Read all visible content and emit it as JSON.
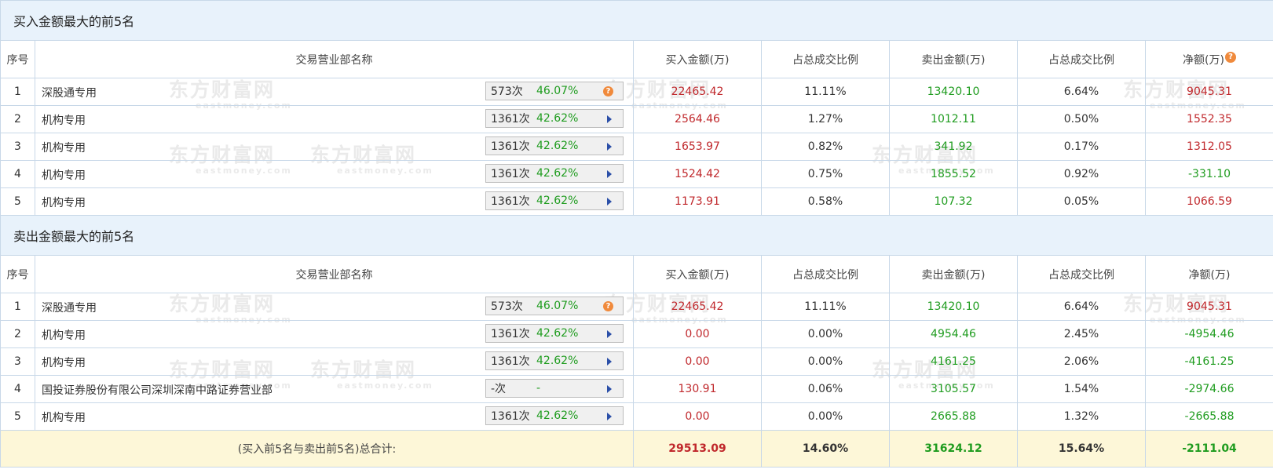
{
  "buy_section": {
    "title": "买入金额最大的前5名",
    "headers": [
      "序号",
      "交易营业部名称",
      "买入金额(万)",
      "占总成交比例",
      "卖出金额(万)",
      "占总成交比例",
      "净额(万)"
    ],
    "rows": [
      {
        "idx": "1",
        "name": "深股通专用",
        "count": "573次",
        "pct": "46.07%",
        "icon": "question-icon",
        "buy": "22465.42",
        "buy_ratio": "11.11%",
        "sell": "13420.10",
        "sell_ratio": "6.64%",
        "net": "9045.31"
      },
      {
        "idx": "2",
        "name": "机构专用",
        "count": "1361次",
        "pct": "42.62%",
        "icon": "arrow-right-icon",
        "buy": "2564.46",
        "buy_ratio": "1.27%",
        "sell": "1012.11",
        "sell_ratio": "0.50%",
        "net": "1552.35"
      },
      {
        "idx": "3",
        "name": "机构专用",
        "count": "1361次",
        "pct": "42.62%",
        "icon": "arrow-right-icon",
        "buy": "1653.97",
        "buy_ratio": "0.82%",
        "sell": "341.92",
        "sell_ratio": "0.17%",
        "net": "1312.05"
      },
      {
        "idx": "4",
        "name": "机构专用",
        "count": "1361次",
        "pct": "42.62%",
        "icon": "arrow-right-icon",
        "buy": "1524.42",
        "buy_ratio": "0.75%",
        "sell": "1855.52",
        "sell_ratio": "0.92%",
        "net": "-331.10"
      },
      {
        "idx": "5",
        "name": "机构专用",
        "count": "1361次",
        "pct": "42.62%",
        "icon": "arrow-right-icon",
        "buy": "1173.91",
        "buy_ratio": "0.58%",
        "sell": "107.32",
        "sell_ratio": "0.05%",
        "net": "1066.59"
      }
    ]
  },
  "sell_section": {
    "title": "卖出金额最大的前5名",
    "headers": [
      "序号",
      "交易营业部名称",
      "买入金额(万)",
      "占总成交比例",
      "卖出金额(万)",
      "占总成交比例",
      "净额(万)"
    ],
    "rows": [
      {
        "idx": "1",
        "name": "深股通专用",
        "count": "573次",
        "pct": "46.07%",
        "icon": "question-icon",
        "buy": "22465.42",
        "buy_ratio": "11.11%",
        "sell": "13420.10",
        "sell_ratio": "6.64%",
        "net": "9045.31"
      },
      {
        "idx": "2",
        "name": "机构专用",
        "count": "1361次",
        "pct": "42.62%",
        "icon": "arrow-right-icon",
        "buy": "0.00",
        "buy_ratio": "0.00%",
        "sell": "4954.46",
        "sell_ratio": "2.45%",
        "net": "-4954.46"
      },
      {
        "idx": "3",
        "name": "机构专用",
        "count": "1361次",
        "pct": "42.62%",
        "icon": "arrow-right-icon",
        "buy": "0.00",
        "buy_ratio": "0.00%",
        "sell": "4161.25",
        "sell_ratio": "2.06%",
        "net": "-4161.25"
      },
      {
        "idx": "4",
        "name": "国投证券股份有限公司深圳深南中路证券营业部",
        "count": "-次",
        "pct": "-",
        "icon": "arrow-right-icon",
        "buy": "130.91",
        "buy_ratio": "0.06%",
        "sell": "3105.57",
        "sell_ratio": "1.54%",
        "net": "-2974.66"
      },
      {
        "idx": "5",
        "name": "机构专用",
        "count": "1361次",
        "pct": "42.62%",
        "icon": "arrow-right-icon",
        "buy": "0.00",
        "buy_ratio": "0.00%",
        "sell": "2665.88",
        "sell_ratio": "1.32%",
        "net": "-2665.88"
      }
    ]
  },
  "total": {
    "label": "(买入前5名与卖出前5名)总合计:",
    "buy": "29513.09",
    "buy_ratio": "14.60%",
    "sell": "31624.12",
    "sell_ratio": "15.64%",
    "net": "-2111.04"
  },
  "help_mark": "?",
  "watermark": {
    "cn": "东方财富网",
    "en": "eastmoney.com"
  },
  "colors": {
    "positive": "#c0282c",
    "negative": "#1f9c1f",
    "header_bg": "#e8f2fb",
    "total_bg": "#fdf7d8",
    "border": "#c8d8e8"
  }
}
